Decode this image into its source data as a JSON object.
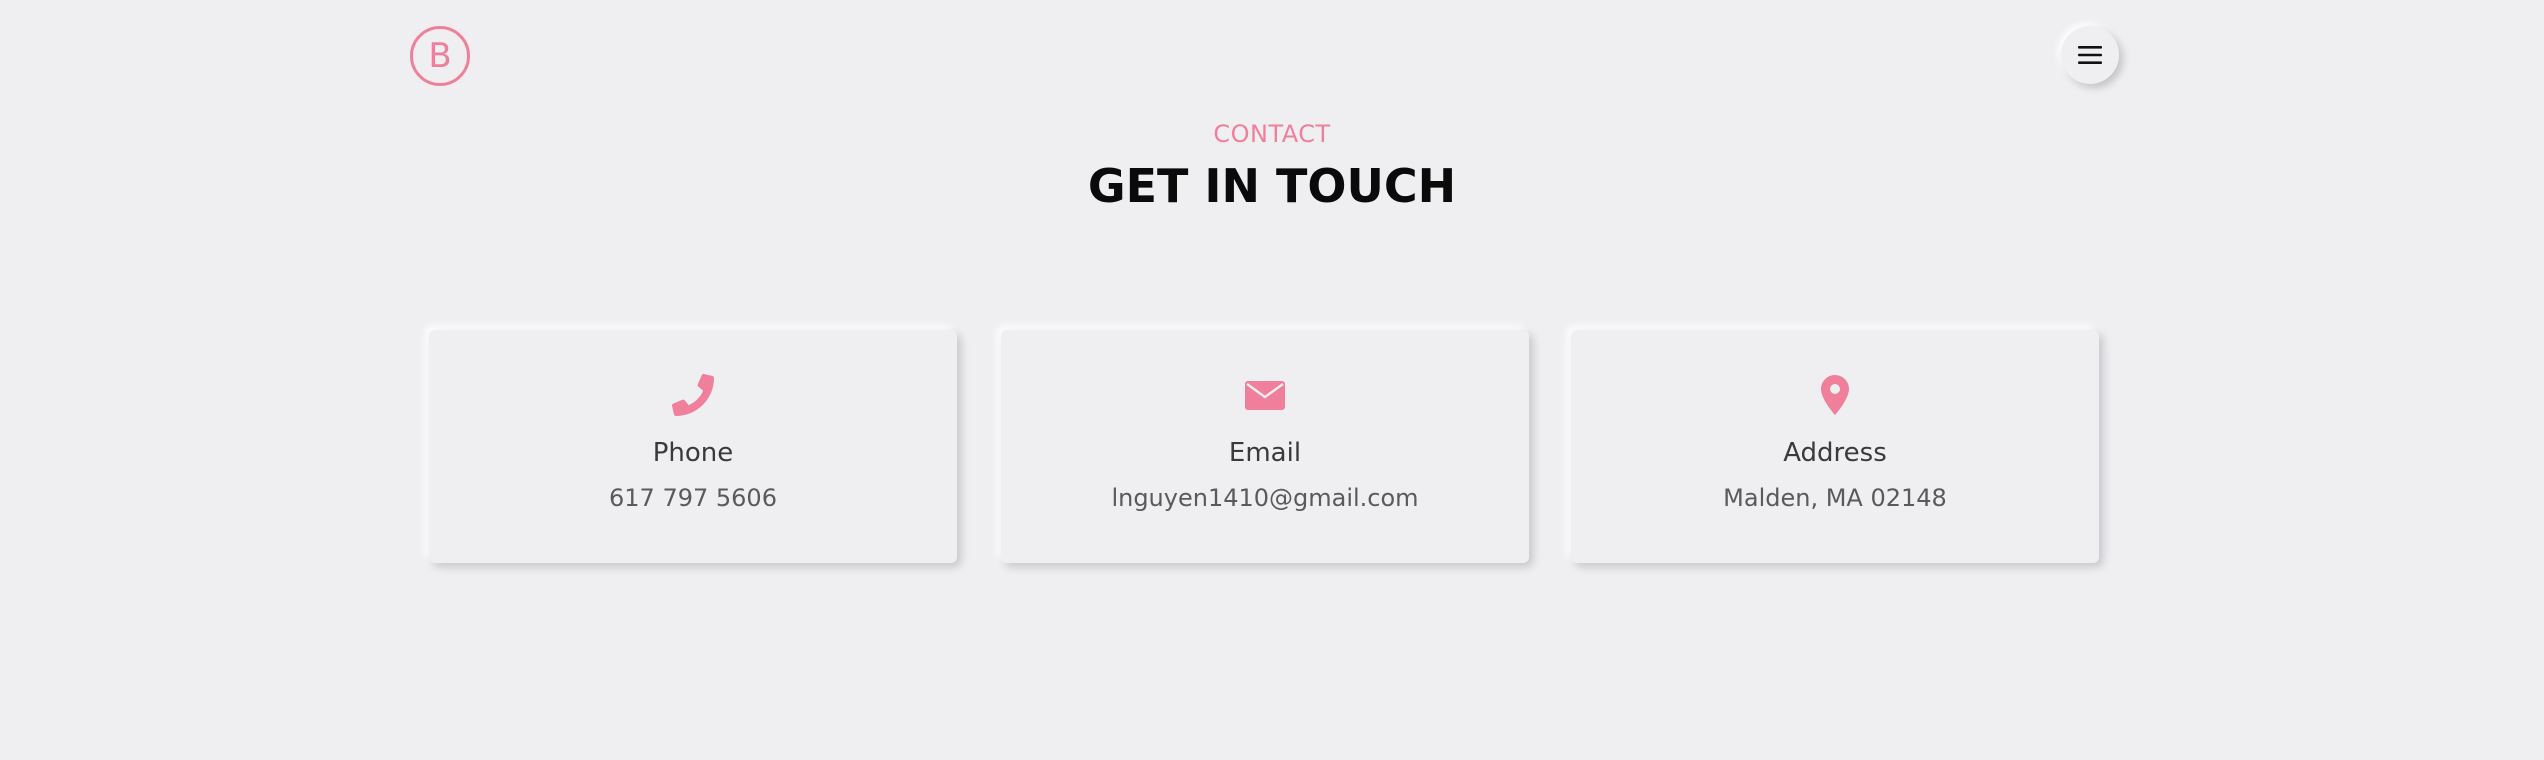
{
  "header": {
    "logo_letter": "B",
    "menu_icon": "hamburger-icon"
  },
  "section": {
    "label": "CONTACT",
    "title": "GET IN TOUCH"
  },
  "colors": {
    "accent": "#f07f9c",
    "background": "#efeff2",
    "title": "#0a0a0a",
    "card_title": "#3a3a3a",
    "card_value": "#5a5a5a"
  },
  "cards": [
    {
      "icon": "phone-icon",
      "title": "Phone",
      "value": "617 797 5606"
    },
    {
      "icon": "envelope-icon",
      "title": "Email",
      "value": "lnguyen1410@gmail.com"
    },
    {
      "icon": "map-pin-icon",
      "title": "Address",
      "value": "Malden, MA 02148"
    }
  ]
}
